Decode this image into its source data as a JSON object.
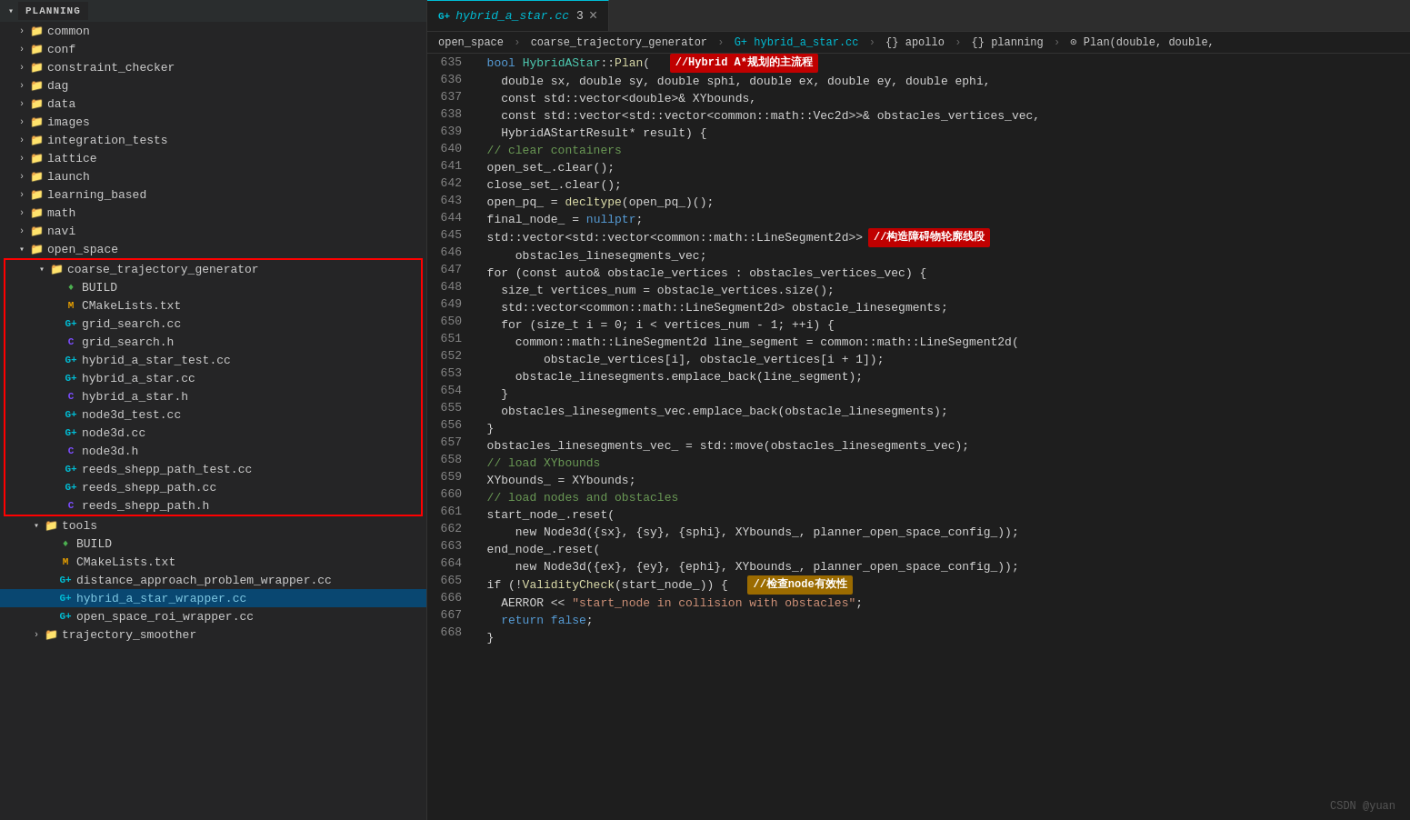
{
  "sidebar": {
    "section": "PLANNING",
    "items": [
      {
        "id": "common",
        "label": "common",
        "indent": 1,
        "type": "folder",
        "expanded": false
      },
      {
        "id": "conf",
        "label": "conf",
        "indent": 1,
        "type": "folder",
        "expanded": false
      },
      {
        "id": "constraint_checker",
        "label": "constraint_checker",
        "indent": 1,
        "type": "folder",
        "expanded": false
      },
      {
        "id": "dag",
        "label": "dag",
        "indent": 1,
        "type": "folder",
        "expanded": false
      },
      {
        "id": "data",
        "label": "data",
        "indent": 1,
        "type": "folder",
        "expanded": false
      },
      {
        "id": "images",
        "label": "images",
        "indent": 1,
        "type": "folder",
        "expanded": false
      },
      {
        "id": "integration_tests",
        "label": "integration_tests",
        "indent": 1,
        "type": "folder",
        "expanded": false
      },
      {
        "id": "lattice",
        "label": "lattice",
        "indent": 1,
        "type": "folder",
        "expanded": false
      },
      {
        "id": "launch",
        "label": "launch",
        "indent": 1,
        "type": "folder",
        "expanded": false
      },
      {
        "id": "learning_based",
        "label": "learning_based",
        "indent": 1,
        "type": "folder",
        "expanded": false
      },
      {
        "id": "math",
        "label": "math",
        "indent": 1,
        "type": "folder",
        "expanded": false
      },
      {
        "id": "navi",
        "label": "navi",
        "indent": 1,
        "type": "folder",
        "expanded": false
      },
      {
        "id": "open_space",
        "label": "open_space",
        "indent": 1,
        "type": "folder",
        "expanded": true
      },
      {
        "id": "coarse_trajectory_generator",
        "label": "coarse_trajectory_generator",
        "indent": 2,
        "type": "folder",
        "expanded": true,
        "redBorderStart": true
      },
      {
        "id": "BUILD",
        "label": "BUILD",
        "indent": 3,
        "type": "build"
      },
      {
        "id": "CMakeLists.txt",
        "label": "CMakeLists.txt",
        "indent": 3,
        "type": "cmake"
      },
      {
        "id": "grid_search.cc",
        "label": "grid_search.cc",
        "indent": 3,
        "type": "cc"
      },
      {
        "id": "grid_search.h",
        "label": "grid_search.h",
        "indent": 3,
        "type": "h"
      },
      {
        "id": "hybrid_a_star_test.cc",
        "label": "hybrid_a_star_test.cc",
        "indent": 3,
        "type": "cc"
      },
      {
        "id": "hybrid_a_star.cc",
        "label": "hybrid_a_star.cc",
        "indent": 3,
        "type": "cc"
      },
      {
        "id": "hybrid_a_star.h",
        "label": "hybrid_a_star.h",
        "indent": 3,
        "type": "h"
      },
      {
        "id": "node3d_test.cc",
        "label": "node3d_test.cc",
        "indent": 3,
        "type": "cc"
      },
      {
        "id": "node3d.cc",
        "label": "node3d.cc",
        "indent": 3,
        "type": "cc"
      },
      {
        "id": "node3d.h",
        "label": "node3d.h",
        "indent": 3,
        "type": "h"
      },
      {
        "id": "reeds_shepp_path_test.cc",
        "label": "reeds_shepp_path_test.cc",
        "indent": 3,
        "type": "cc"
      },
      {
        "id": "reeds_shepp_path.cc",
        "label": "reeds_shepp_path.cc",
        "indent": 3,
        "type": "cc"
      },
      {
        "id": "reeds_shepp_path.h",
        "label": "reeds_shepp_path.h",
        "indent": 3,
        "type": "h",
        "redBorderEnd": true
      },
      {
        "id": "tools",
        "label": "tools",
        "indent": 2,
        "type": "folder",
        "expanded": true
      },
      {
        "id": "tools-BUILD",
        "label": "BUILD",
        "indent": 3,
        "type": "build"
      },
      {
        "id": "tools-CMakeLists.txt",
        "label": "CMakeLists.txt",
        "indent": 3,
        "type": "cmake"
      },
      {
        "id": "distance_approach_problem_wrapper.cc",
        "label": "distance_approach_problem_wrapper.cc",
        "indent": 3,
        "type": "cc"
      },
      {
        "id": "hybrid_a_star_wrapper.cc",
        "label": "hybrid_a_star_wrapper.cc",
        "indent": 3,
        "type": "cc",
        "active": true
      },
      {
        "id": "open_space_roi_wrapper.cc",
        "label": "open_space_roi_wrapper.cc",
        "indent": 3,
        "type": "cc"
      },
      {
        "id": "trajectory_smoother",
        "label": "trajectory_smoother",
        "indent": 2,
        "type": "folder",
        "expanded": false
      }
    ]
  },
  "editor": {
    "tab": {
      "icon": "cc",
      "filename": "hybrid_a_star.cc",
      "number": "3",
      "active": true
    },
    "breadcrumb": "open_space  >  coarse_trajectory_generator  >  hybrid_a_star.cc  >  {}  apollo  >  {}  planning  >  Plan(double, double,",
    "lines": [
      {
        "num": 635,
        "tokens": [
          {
            "t": "  ",
            "c": "plain"
          },
          {
            "t": "bool",
            "c": "kw"
          },
          {
            "t": " ",
            "c": "plain"
          },
          {
            "t": "HybridAStar",
            "c": "cls"
          },
          {
            "t": "::",
            "c": "punct"
          },
          {
            "t": "Plan",
            "c": "fn"
          },
          {
            "t": "(",
            "c": "punct"
          },
          {
            "t": "  ",
            "c": "plain"
          },
          {
            "t": "//Hybrid A*规划的主流程",
            "c": "annot-red"
          }
        ]
      },
      {
        "num": 636,
        "tokens": [
          {
            "t": "    double sx, double sy, double sphi, double ex, double ey, double ephi,",
            "c": "plain"
          }
        ]
      },
      {
        "num": 637,
        "tokens": [
          {
            "t": "    const std::vector<double>& XYbounds,",
            "c": "plain"
          }
        ]
      },
      {
        "num": 638,
        "tokens": [
          {
            "t": "    const std::vector<std::vector<common::math::Vec2d>>& obstacles_vertices_vec,",
            "c": "plain"
          }
        ]
      },
      {
        "num": 639,
        "tokens": [
          {
            "t": "    HybridAStartResult* result) {",
            "c": "plain"
          }
        ]
      },
      {
        "num": 640,
        "tokens": [
          {
            "t": "  // clear containers",
            "c": "cmt"
          }
        ]
      },
      {
        "num": 641,
        "tokens": [
          {
            "t": "  open_set_.clear();",
            "c": "plain"
          }
        ]
      },
      {
        "num": 642,
        "tokens": [
          {
            "t": "  close_set_.clear();",
            "c": "plain"
          }
        ]
      },
      {
        "num": 643,
        "tokens": [
          {
            "t": "  open_pq_ = decltype(open_pq_)();",
            "c": "plain"
          }
        ]
      },
      {
        "num": 644,
        "tokens": [
          {
            "t": "  final_node_ = nullptr;",
            "c": "plain"
          }
        ]
      },
      {
        "num": 645,
        "tokens": [
          {
            "t": "  std::vector<std::vector<common::math::LineSegment2d>>  ",
            "c": "plain"
          },
          {
            "t": "//构造障碍物轮廓线段",
            "c": "annot-red"
          }
        ]
      },
      {
        "num": 646,
        "tokens": [
          {
            "t": "      obstacles_linesegments_vec;",
            "c": "plain"
          }
        ]
      },
      {
        "num": 647,
        "tokens": [
          {
            "t": "  for (const auto& obstacle_vertices : obstacles_vertices_vec) {",
            "c": "plain"
          }
        ]
      },
      {
        "num": 648,
        "tokens": [
          {
            "t": "    size_t vertices_num = obstacle_vertices.size();",
            "c": "plain"
          }
        ]
      },
      {
        "num": 649,
        "tokens": [
          {
            "t": "    std::vector<common::math::LineSegment2d> obstacle_linesegments;",
            "c": "plain"
          }
        ]
      },
      {
        "num": 650,
        "tokens": [
          {
            "t": "    for (size_t i = 0; i < vertices_num - 1; ++i) {",
            "c": "plain"
          }
        ]
      },
      {
        "num": 651,
        "tokens": [
          {
            "t": "      common::math::LineSegment2d line_segment = common::math::LineSegment2d(",
            "c": "plain"
          }
        ]
      },
      {
        "num": 652,
        "tokens": [
          {
            "t": "          obstacle_vertices[i], obstacle_vertices[i + 1]);",
            "c": "plain"
          }
        ]
      },
      {
        "num": 653,
        "tokens": [
          {
            "t": "      obstacle_linesegments.emplace_back(line_segment);",
            "c": "plain"
          }
        ]
      },
      {
        "num": 654,
        "tokens": [
          {
            "t": "    }",
            "c": "plain"
          }
        ]
      },
      {
        "num": 655,
        "tokens": [
          {
            "t": "    obstacles_linesegments_vec.emplace_back(obstacle_linesegments);",
            "c": "plain"
          }
        ]
      },
      {
        "num": 656,
        "tokens": [
          {
            "t": "  }",
            "c": "plain"
          }
        ]
      },
      {
        "num": 657,
        "tokens": [
          {
            "t": "  obstacles_linesegments_vec_ = std::move(obstacles_linesegments_vec);",
            "c": "plain"
          }
        ]
      },
      {
        "num": 658,
        "tokens": [
          {
            "t": "  // load XYbounds",
            "c": "cmt"
          }
        ]
      },
      {
        "num": 659,
        "tokens": [
          {
            "t": "  XYbounds_ = XYbounds;",
            "c": "plain"
          }
        ]
      },
      {
        "num": 660,
        "tokens": [
          {
            "t": "  // load nodes and obstacles",
            "c": "cmt"
          }
        ]
      },
      {
        "num": 661,
        "tokens": [
          {
            "t": "  start_node_.reset(",
            "c": "plain"
          }
        ]
      },
      {
        "num": 662,
        "tokens": [
          {
            "t": "      new Node3d({sx}, {sy}, {sphi}, XYbounds_, planner_open_space_config_));",
            "c": "plain"
          }
        ]
      },
      {
        "num": 663,
        "tokens": [
          {
            "t": "  end_node_.reset(",
            "c": "plain"
          }
        ]
      },
      {
        "num": 664,
        "tokens": [
          {
            "t": "      new Node3d({ex}, {ey}, {ephi}, XYbounds_, planner_open_space_config_));",
            "c": "plain"
          }
        ]
      },
      {
        "num": 665,
        "tokens": [
          {
            "t": "  if (!ValidityCheck(start_node_)) {  ",
            "c": "plain"
          },
          {
            "t": "//检查node有效性",
            "c": "annot-yellow"
          }
        ]
      },
      {
        "num": 666,
        "tokens": [
          {
            "t": "    AERROR << \"start_node in collision with obstacles\";",
            "c": "plain"
          }
        ]
      },
      {
        "num": 667,
        "tokens": [
          {
            "t": "    return false;",
            "c": "plain"
          }
        ]
      },
      {
        "num": 668,
        "tokens": [
          {
            "t": "  }",
            "c": "plain"
          }
        ]
      }
    ]
  },
  "watermark": "CSDN @yuan"
}
